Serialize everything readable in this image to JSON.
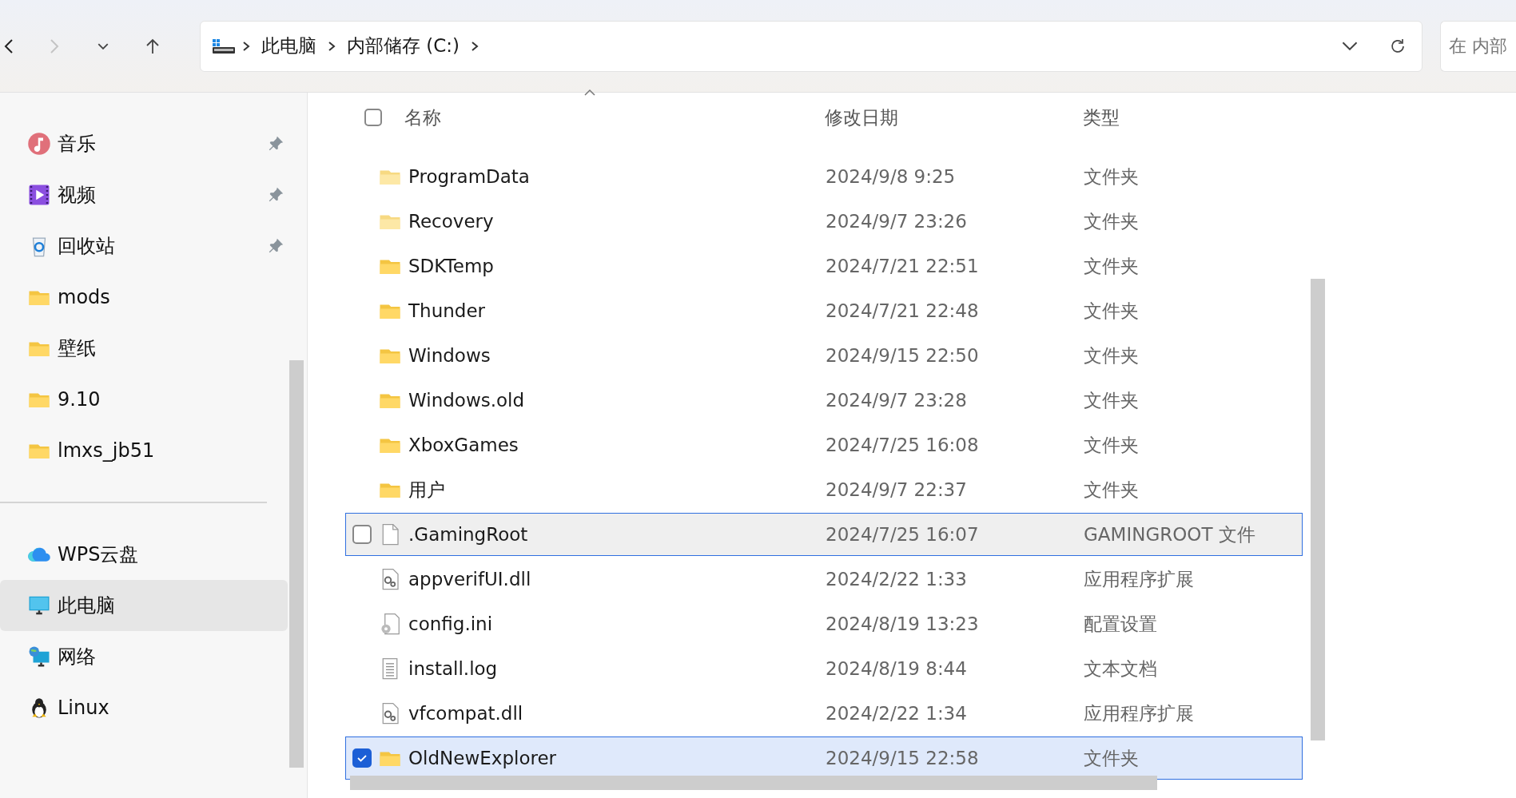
{
  "toolbar": {
    "back_disabled": false,
    "forward_disabled": true
  },
  "address": {
    "crumbs": [
      "此电脑",
      "内部储存 (C:)"
    ]
  },
  "search": {
    "placeholder": "在 内部"
  },
  "sidebar": {
    "items": [
      {
        "label": "音乐",
        "kind": "music",
        "pinned": true,
        "selected": false
      },
      {
        "label": "视频",
        "kind": "video",
        "pinned": true,
        "selected": false
      },
      {
        "label": "回收站",
        "kind": "recycle",
        "pinned": true,
        "selected": false
      },
      {
        "label": "mods",
        "kind": "folder",
        "pinned": false,
        "selected": false
      },
      {
        "label": "壁纸",
        "kind": "folder",
        "pinned": false,
        "selected": false
      },
      {
        "label": "9.10",
        "kind": "folder",
        "pinned": false,
        "selected": false
      },
      {
        "label": "lmxs_jb51",
        "kind": "folder",
        "pinned": false,
        "selected": false
      },
      {
        "kind": "divider"
      },
      {
        "label": "WPS云盘",
        "kind": "cloud",
        "pinned": false,
        "selected": false
      },
      {
        "label": "此电脑",
        "kind": "pc",
        "pinned": false,
        "selected": true
      },
      {
        "label": "网络",
        "kind": "network",
        "pinned": false,
        "selected": false
      },
      {
        "label": "Linux",
        "kind": "penguin",
        "pinned": false,
        "selected": false
      }
    ]
  },
  "table": {
    "all_checked": false,
    "columns": [
      "名称",
      "修改日期",
      "类型"
    ],
    "rows": [
      {
        "name": "ProgramData",
        "date": "2024/9/8 9:25",
        "type": "文件夹",
        "kind": "hiddenfolder",
        "selected": false,
        "hovered": false
      },
      {
        "name": "Recovery",
        "date": "2024/9/7 23:26",
        "type": "文件夹",
        "kind": "hiddenfolder",
        "selected": false,
        "hovered": false
      },
      {
        "name": "SDKTemp",
        "date": "2024/7/21 22:51",
        "type": "文件夹",
        "kind": "folder",
        "selected": false,
        "hovered": false
      },
      {
        "name": "Thunder",
        "date": "2024/7/21 22:48",
        "type": "文件夹",
        "kind": "folder",
        "selected": false,
        "hovered": false
      },
      {
        "name": "Windows",
        "date": "2024/9/15 22:50",
        "type": "文件夹",
        "kind": "folder",
        "selected": false,
        "hovered": false
      },
      {
        "name": "Windows.old",
        "date": "2024/9/7 23:28",
        "type": "文件夹",
        "kind": "folder",
        "selected": false,
        "hovered": false
      },
      {
        "name": "XboxGames",
        "date": "2024/7/25 16:08",
        "type": "文件夹",
        "kind": "folder",
        "selected": false,
        "hovered": false
      },
      {
        "name": "用户",
        "date": "2024/9/7 22:37",
        "type": "文件夹",
        "kind": "folder",
        "selected": false,
        "hovered": false
      },
      {
        "name": ".GamingRoot",
        "date": "2024/7/25 16:07",
        "type": "GAMINGROOT 文件",
        "kind": "file",
        "selected": false,
        "hovered": true
      },
      {
        "name": "appverifUI.dll",
        "date": "2024/2/22 1:33",
        "type": "应用程序扩展",
        "kind": "dll",
        "selected": false,
        "hovered": false
      },
      {
        "name": "config.ini",
        "date": "2024/8/19 13:23",
        "type": "配置设置",
        "kind": "ini",
        "selected": false,
        "hovered": false
      },
      {
        "name": "install.log",
        "date": "2024/8/19 8:44",
        "type": "文本文档",
        "kind": "text",
        "selected": false,
        "hovered": false
      },
      {
        "name": "vfcompat.dll",
        "date": "2024/2/22 1:34",
        "type": "应用程序扩展",
        "kind": "dll",
        "selected": false,
        "hovered": false
      },
      {
        "name": "OldNewExplorer",
        "date": "2024/9/15 22:58",
        "type": "文件夹",
        "kind": "folder",
        "selected": true,
        "hovered": false
      }
    ]
  }
}
